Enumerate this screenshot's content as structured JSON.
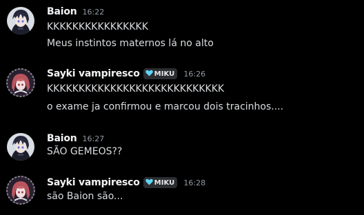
{
  "messages": [
    {
      "author": "Baion",
      "time": "16:22",
      "tag": null,
      "avatar": "baion-avatar",
      "lines": [
        "KKKKKKKKKKKKKKKK",
        "Meus instintos maternos lá no alto"
      ]
    },
    {
      "author": "Sayki vampiresco",
      "time": "16:26",
      "tag": {
        "label": "MIKU",
        "icon": "heart-icon",
        "color": "#5ed5f5"
      },
      "avatar": "sayki-avatar",
      "lines": [
        "KKKKKKKKKKKKKKKKKKKKKKKKKKKK",
        "o exame ja confirmou e marcou dois tracinhos...."
      ]
    },
    {
      "author": "Baion",
      "time": "16:27",
      "tag": null,
      "avatar": "baion-avatar",
      "lines": [
        "SÃO GEMEOS??"
      ]
    },
    {
      "author": "Sayki vampiresco",
      "time": "16:28",
      "tag": {
        "label": "MIKU",
        "icon": "heart-icon",
        "color": "#5ed5f5"
      },
      "avatar": "sayki-avatar",
      "lines": [
        "são Baion são..."
      ]
    }
  ],
  "colors": {
    "background": "#000000",
    "username": "#f2f3f5",
    "timestamp": "#949ba4",
    "message_text": "#dbdee1",
    "tag_bg": "#2b2d31"
  }
}
